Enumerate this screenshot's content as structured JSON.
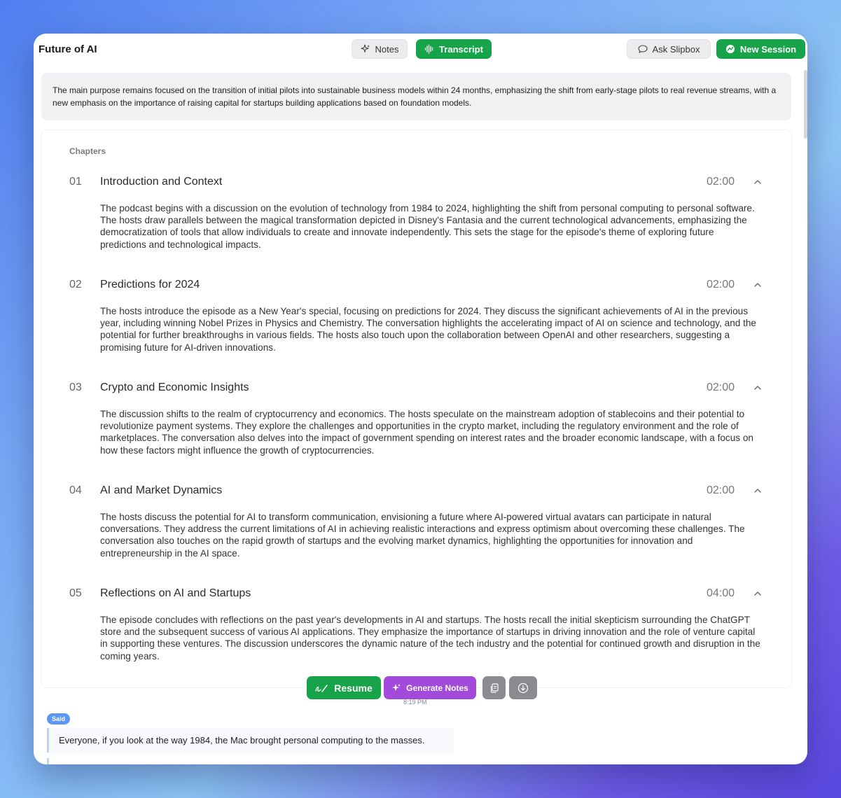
{
  "window": {
    "title": "Future of AI"
  },
  "toolbar": {
    "notes_label": "Notes",
    "transcript_label": "Transcript",
    "ask_label": "Ask Slipbox",
    "new_session_label": "New Session"
  },
  "summary": {
    "text": "The main purpose remains focused on the transition of initial pilots into sustainable business models within 24 months, emphasizing the shift from early-stage pilots to real revenue streams, with a new emphasis on the importance of raising capital for startups building applications based on foundation models."
  },
  "chapters": {
    "label": "Chapters",
    "items": [
      {
        "num": "01",
        "title": "Introduction and Context",
        "time": "02:00",
        "text": "The podcast begins with a discussion on the evolution of technology from 1984 to 2024, highlighting the shift from personal computing to personal software. The hosts draw parallels between the magical transformation depicted in Disney's Fantasia and the current technological advancements, emphasizing the democratization of tools that allow individuals to create and innovate independently. This sets the stage for the episode's theme of exploring future predictions and technological impacts."
      },
      {
        "num": "02",
        "title": "Predictions for 2024",
        "time": "02:00",
        "text": "The hosts introduce the episode as a New Year's special, focusing on predictions for 2024. They discuss the significant achievements of AI in the previous year, including winning Nobel Prizes in Physics and Chemistry. The conversation highlights the accelerating impact of AI on science and technology, and the potential for further breakthroughs in various fields. The hosts also touch upon the collaboration between OpenAI and other researchers, suggesting a promising future for AI-driven innovations."
      },
      {
        "num": "03",
        "title": "Crypto and Economic Insights",
        "time": "02:00",
        "text": "The discussion shifts to the realm of cryptocurrency and economics. The hosts speculate on the mainstream adoption of stablecoins and their potential to revolutionize payment systems. They explore the challenges and opportunities in the crypto market, including the regulatory environment and the role of marketplaces. The conversation also delves into the impact of government spending on interest rates and the broader economic landscape, with a focus on how these factors might influence the growth of cryptocurrencies."
      },
      {
        "num": "04",
        "title": "AI and Market Dynamics",
        "time": "02:00",
        "text": "The hosts discuss the potential for AI to transform communication, envisioning a future where AI-powered virtual avatars can participate in natural conversations. They address the current limitations of AI in achieving realistic interactions and express optimism about overcoming these challenges. The conversation also touches on the rapid growth of startups and the evolving market dynamics, highlighting the opportunities for innovation and entrepreneurship in the AI space."
      },
      {
        "num": "05",
        "title": "Reflections on AI and Startups",
        "time": "04:00",
        "text": "The episode concludes with reflections on the past year's developments in AI and startups. The hosts recall the initial skepticism surrounding the ChatGPT store and the subsequent success of various AI applications. They emphasize the importance of startups in driving innovation and the role of venture capital in supporting these ventures. The discussion underscores the dynamic nature of the tech industry and the potential for continued growth and disruption in the coming years."
      }
    ]
  },
  "actions": {
    "resume_label": "Resume",
    "generate_label": "Generate Notes"
  },
  "transcript": {
    "timestamp": "8:19 PM",
    "speaker_badge": "Said",
    "line": "Everyone, if you look at the way 1984, the Mac brought personal computing to the masses."
  },
  "colors": {
    "accent_green": "#17a34a",
    "accent_purple": "#a24ad9",
    "badge_blue": "#5b97f2"
  }
}
